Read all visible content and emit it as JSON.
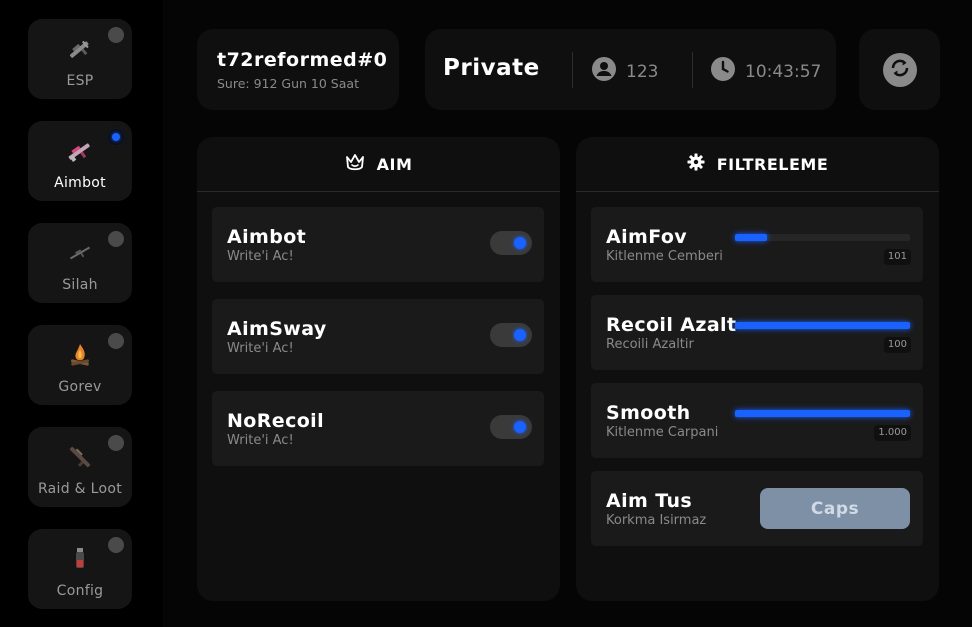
{
  "colors": {
    "accent": "#1a62ff",
    "panel": "#0f0f0f",
    "row": "#1a1a1a",
    "caps_button": "#7d90a6"
  },
  "sidebar": {
    "items": [
      {
        "label": "ESP",
        "icon": "esp-rifle-icon",
        "active": false
      },
      {
        "label": "Aimbot",
        "icon": "aimbot-rifle-icon",
        "active": true
      },
      {
        "label": "Silah",
        "icon": "silah-rifle-icon",
        "active": false
      },
      {
        "label": "Gorev",
        "icon": "campfire-icon",
        "active": false
      },
      {
        "label": "Raid & Loot",
        "icon": "loot-weapon-icon",
        "active": false
      },
      {
        "label": "Config",
        "icon": "config-flask-icon",
        "active": false
      }
    ]
  },
  "header": {
    "user": {
      "name": "t72reformed#0",
      "subtitle": "Sure: 912 Gun 10 Saat"
    },
    "status": {
      "mode": "Private",
      "user_count": "123",
      "time": "10:43:57",
      "user_icon": "user-icon",
      "clock_icon": "clock-icon"
    },
    "refresh_icon": "refresh-icon"
  },
  "aim_panel": {
    "title": "AIM",
    "icon": "crown-icon",
    "rows": [
      {
        "title": "Aimbot",
        "subtitle": "Write'i Ac!",
        "enabled": true
      },
      {
        "title": "AimSway",
        "subtitle": "Write'i Ac!",
        "enabled": true
      },
      {
        "title": "NoRecoil",
        "subtitle": "Write'i Ac!",
        "enabled": true
      }
    ]
  },
  "filter_panel": {
    "title": "FILTRELEME",
    "icon": "gear-icon",
    "sliders": [
      {
        "title": "AimFov",
        "subtitle": "Kitlenme Cemberi",
        "value": "101",
        "fill_fraction": 0.18
      },
      {
        "title": "Recoil Azalt",
        "subtitle": "Recoili Azaltir",
        "value": "100",
        "fill_fraction": 1.0
      },
      {
        "title": "Smooth",
        "subtitle": "Kitlenme Carpani",
        "value": "1.000",
        "fill_fraction": 1.0
      }
    ],
    "keybind": {
      "title": "Aim Tus",
      "subtitle": "Korkma Isirmaz",
      "key": "Caps"
    }
  }
}
